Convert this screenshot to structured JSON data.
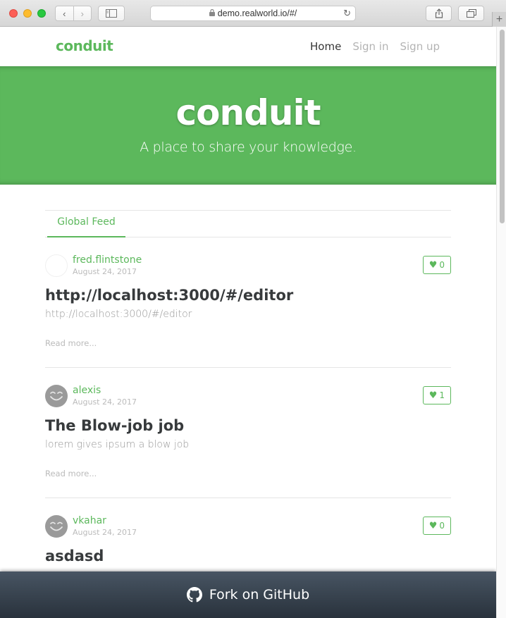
{
  "browser": {
    "url": "demo.realworld.io/#/",
    "back_glyph": "‹",
    "forward_glyph": "›",
    "plus_glyph": "+"
  },
  "navbar": {
    "brand": "conduit",
    "links": [
      "Home",
      "Sign in",
      "Sign up"
    ],
    "active_link": "Home"
  },
  "banner": {
    "title": "conduit",
    "subtitle": "A place to share your knowledge."
  },
  "feed": {
    "tab_label": "Global Feed",
    "articles": [
      {
        "author": "fred.flintstone",
        "date": "August 24, 2017",
        "likes": "0",
        "title": "http://localhost:3000/#/editor",
        "description": "http://localhost:3000/#/editor",
        "read_more": "Read more...",
        "avatar": "blank"
      },
      {
        "author": "alexis",
        "date": "August 24, 2017",
        "likes": "1",
        "title": "The Blow-job job",
        "description": "lorem gives ipsum a blow job",
        "read_more": "Read more...",
        "avatar": "smiley"
      },
      {
        "author": "vkahar",
        "date": "August 24, 2017",
        "likes": "0",
        "title": "asdasd",
        "description": "",
        "read_more": "",
        "avatar": "smiley"
      }
    ]
  },
  "footer": {
    "label": "Fork on GitHub"
  },
  "colors": {
    "brand_green": "#5cb85c",
    "footer_dark": "#29323c"
  },
  "icons": {
    "heart": "♥",
    "lock": "🔒",
    "reload": "↻"
  }
}
